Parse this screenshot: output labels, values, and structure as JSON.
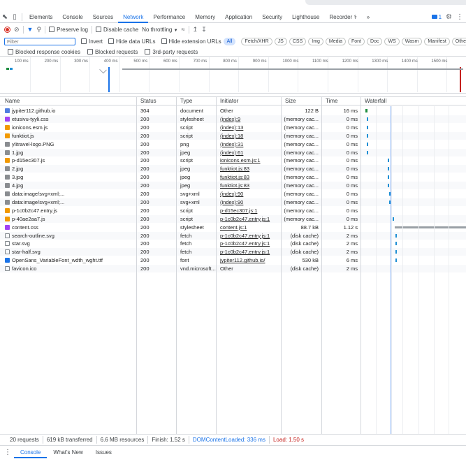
{
  "tabs": {
    "items": [
      "Elements",
      "Console",
      "Sources",
      "Network",
      "Performance",
      "Memory",
      "Application",
      "Security",
      "Lighthouse",
      "Recorder"
    ],
    "active": "Network",
    "issue_count": "1"
  },
  "toolbar": {
    "preserve_log": "Preserve log",
    "disable_cache": "Disable cache",
    "throttling": "No throttling"
  },
  "filter": {
    "placeholder": "Filter",
    "invert": "Invert",
    "hide_data_urls": "Hide data URLs",
    "hide_extension_urls": "Hide extension URLs",
    "types": [
      "All",
      "Fetch/XHR",
      "JS",
      "CSS",
      "Img",
      "Media",
      "Font",
      "Doc",
      "WS",
      "Wasm",
      "Manifest",
      "Other"
    ],
    "active_type": "All"
  },
  "blocked": {
    "cookies": "Blocked response cookies",
    "requests": "Blocked requests",
    "third_party": "3rd-party requests"
  },
  "overview": {
    "ticks": [
      "100 ms",
      "200 ms",
      "300 ms",
      "400 ms",
      "500 ms",
      "600 ms",
      "700 ms",
      "800 ms",
      "900 ms",
      "1000 ms",
      "1100 ms",
      "1200 ms",
      "1300 ms",
      "1400 ms",
      "1500 ms"
    ]
  },
  "columns": {
    "name": "Name",
    "status": "Status",
    "type": "Type",
    "initiator": "Initiator",
    "size": "Size",
    "time": "Time",
    "waterfall": "Waterfall"
  },
  "rows": [
    {
      "name": "jypiter112.github.io",
      "status": "304",
      "type": "document",
      "initiator": "Other",
      "initiator_link": false,
      "size": "122 B",
      "time": "16 ms",
      "icon": "doc"
    },
    {
      "name": "etusivu-tyyli.css",
      "status": "200",
      "type": "stylesheet",
      "initiator": "(index):9",
      "initiator_link": true,
      "size": "(memory cac...",
      "time": "0 ms",
      "icon": "css"
    },
    {
      "name": "ionicons.esm.js",
      "status": "200",
      "type": "script",
      "initiator": "(index):13",
      "initiator_link": true,
      "size": "(memory cac...",
      "time": "0 ms",
      "icon": "js"
    },
    {
      "name": "funktiot.js",
      "status": "200",
      "type": "script",
      "initiator": "(index):18",
      "initiator_link": true,
      "size": "(memory cac...",
      "time": "0 ms",
      "icon": "js"
    },
    {
      "name": "ylitravel-logo.PNG",
      "status": "200",
      "type": "png",
      "initiator": "(index):31",
      "initiator_link": true,
      "size": "(memory cac...",
      "time": "0 ms",
      "icon": "img"
    },
    {
      "name": "1.jpg",
      "status": "200",
      "type": "jpeg",
      "initiator": "(index):61",
      "initiator_link": true,
      "size": "(memory cac...",
      "time": "0 ms",
      "icon": "img"
    },
    {
      "name": "p-d15ec307.js",
      "status": "200",
      "type": "script",
      "initiator": "ionicons.esm.js:1",
      "initiator_link": true,
      "size": "(memory cac...",
      "time": "0 ms",
      "icon": "js"
    },
    {
      "name": "2.jpg",
      "status": "200",
      "type": "jpeg",
      "initiator": "funktiot.js:83",
      "initiator_link": true,
      "size": "(memory cac...",
      "time": "0 ms",
      "icon": "img"
    },
    {
      "name": "3.jpg",
      "status": "200",
      "type": "jpeg",
      "initiator": "funktiot.js:83",
      "initiator_link": true,
      "size": "(memory cac...",
      "time": "0 ms",
      "icon": "img"
    },
    {
      "name": "4.jpg",
      "status": "200",
      "type": "jpeg",
      "initiator": "funktiot.js:83",
      "initiator_link": true,
      "size": "(memory cac...",
      "time": "0 ms",
      "icon": "img"
    },
    {
      "name": "data:image/svg+xml;...",
      "status": "200",
      "type": "svg+xml",
      "initiator": "(index):90",
      "initiator_link": true,
      "size": "(memory cac...",
      "time": "0 ms",
      "icon": "svg"
    },
    {
      "name": "data:image/svg+xml;...",
      "status": "200",
      "type": "svg+xml",
      "initiator": "(index):90",
      "initiator_link": true,
      "size": "(memory cac...",
      "time": "0 ms",
      "icon": "svg"
    },
    {
      "name": "p-1c0b2c47.entry.js",
      "status": "200",
      "type": "script",
      "initiator": "p-d15ec307.js:1",
      "initiator_link": true,
      "size": "(memory cac...",
      "time": "0 ms",
      "icon": "js"
    },
    {
      "name": "p-40ae2aa7.js",
      "status": "200",
      "type": "script",
      "initiator": "p-1c0b2c47.entry.js:1",
      "initiator_link": true,
      "size": "(memory cac...",
      "time": "0 ms",
      "icon": "js"
    },
    {
      "name": "content.css",
      "status": "200",
      "type": "stylesheet",
      "initiator": "content.js:1",
      "initiator_link": true,
      "size": "88.7 kB",
      "time": "1.12 s",
      "icon": "css"
    },
    {
      "name": "search-outline.svg",
      "status": "200",
      "type": "fetch",
      "initiator": "p-1c0b2c47.entry.js:1",
      "initiator_link": true,
      "size": "(disk cache)",
      "time": "2 ms",
      "icon": "blank"
    },
    {
      "name": "star.svg",
      "status": "200",
      "type": "fetch",
      "initiator": "p-1c0b2c47.entry.js:1",
      "initiator_link": true,
      "size": "(disk cache)",
      "time": "2 ms",
      "icon": "blank"
    },
    {
      "name": "star-half.svg",
      "status": "200",
      "type": "fetch",
      "initiator": "p-1c0b2c47.entry.js:1",
      "initiator_link": true,
      "size": "(disk cache)",
      "time": "2 ms",
      "icon": "blank"
    },
    {
      "name": "OpenSans_VariableFont_wdth_wght.ttf",
      "status": "200",
      "type": "font",
      "initiator": "jypiter112.github.io/",
      "initiator_link": true,
      "size": "530 kB",
      "time": "6 ms",
      "icon": "font"
    },
    {
      "name": "favicon.ico",
      "status": "200",
      "type": "vnd.microsoft...",
      "initiator": "Other",
      "initiator_link": false,
      "size": "(disk cache)",
      "time": "2 ms",
      "icon": "blank"
    }
  ],
  "status": {
    "requests": "20 requests",
    "transferred": "619 kB transferred",
    "resources": "6.6 MB resources",
    "finish": "Finish: 1.52 s",
    "dcl": "DOMContentLoaded: 336 ms",
    "load": "Load: 1.50 s"
  },
  "drawer": {
    "tabs": [
      "Console",
      "What's New",
      "Issues"
    ],
    "active": "Console"
  },
  "colors": {
    "accent": "#1a73e8",
    "waterfall": "#1e8fd4",
    "load_red": "#c5221f",
    "dcl_blue": "#1a73e8"
  }
}
